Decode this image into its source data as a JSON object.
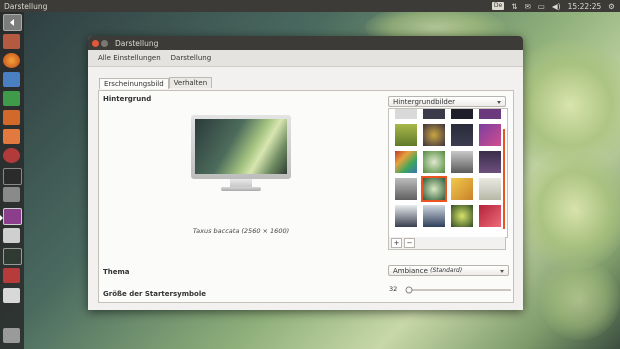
{
  "topbar": {
    "app_title": "Darstellung",
    "keyboard_layout": "De",
    "clock": "15:22:25"
  },
  "window": {
    "title": "Darstellung"
  },
  "breadcrumb": {
    "all_settings": "Alle Einstellungen",
    "current": "Darstellung"
  },
  "tabs": [
    {
      "label": "Erscheinungsbild"
    },
    {
      "label": "Verhalten"
    }
  ],
  "background": {
    "label": "Hintergrund",
    "source_value": "Hintergrundbilder",
    "caption": "Taxus baccata (2560 × 1600)"
  },
  "theme": {
    "label": "Thema",
    "value": "Ambiance",
    "value_suffix": "(Standard)"
  },
  "launcher_size": {
    "label": "Größe der Startersymbole",
    "value": "32"
  },
  "gallery_tools": {
    "add": "+",
    "remove": "−"
  }
}
